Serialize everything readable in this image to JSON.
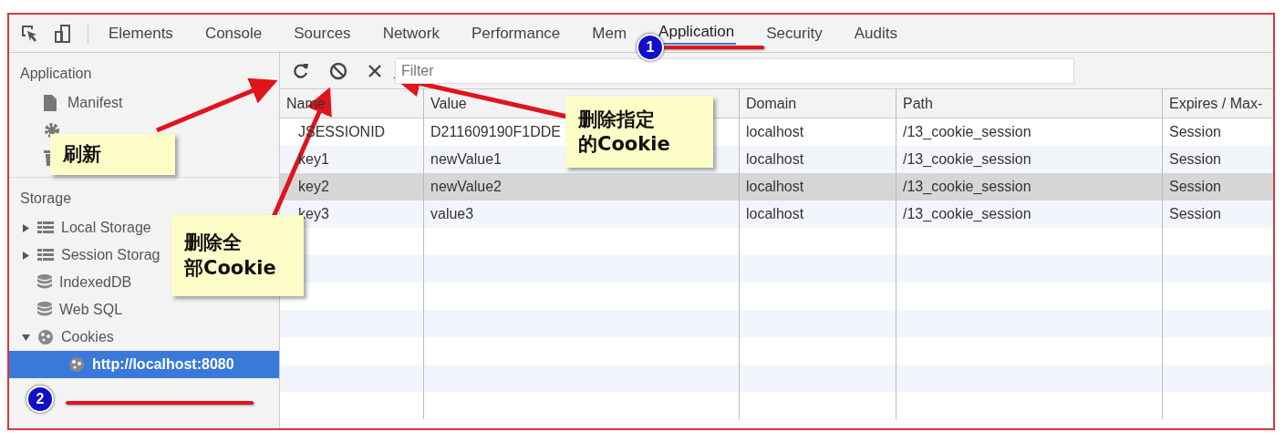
{
  "tabs": [
    {
      "label": "Elements",
      "selected": false
    },
    {
      "label": "Console",
      "selected": false
    },
    {
      "label": "Sources",
      "selected": false
    },
    {
      "label": "Network",
      "selected": false
    },
    {
      "label": "Performance",
      "selected": false
    },
    {
      "label": "Mem",
      "selected": false
    },
    {
      "label": "Application",
      "selected": true
    },
    {
      "label": "Security",
      "selected": false
    },
    {
      "label": "Audits",
      "selected": false
    }
  ],
  "sidebar": {
    "sections": [
      {
        "title": "Application",
        "items": [
          {
            "kind": "file",
            "label": "Manifest"
          },
          {
            "kind": "gear"
          },
          {
            "kind": "trash"
          }
        ]
      },
      {
        "title": "Storage",
        "items": [
          {
            "kind": "grid",
            "label": "Local Storage",
            "expanded": false
          },
          {
            "kind": "grid",
            "label": "Session Storag",
            "expanded": false
          },
          {
            "kind": "database",
            "label": "IndexedDB"
          },
          {
            "kind": "database",
            "label": "Web SQL"
          },
          {
            "kind": "cookie",
            "label": "Cookies",
            "expanded": true,
            "children": [
              {
                "kind": "cookie",
                "label": "http://localhost:8080",
                "selected": true
              }
            ]
          }
        ]
      }
    ]
  },
  "filter": {
    "placeholder": "Filter"
  },
  "table": {
    "columns": [
      "Name",
      "Value",
      "Domain",
      "Path",
      "Expires / Max-"
    ],
    "rows": [
      {
        "cells": [
          "JSESSIONID",
          "D211609190F1DDE",
          "localhost",
          "/13_cookie_session",
          "Session"
        ],
        "selected": false
      },
      {
        "cells": [
          "key1",
          "newValue1",
          "localhost",
          "/13_cookie_session",
          "Session"
        ],
        "selected": false
      },
      {
        "cells": [
          "key2",
          "newValue2",
          "localhost",
          "/13_cookie_session",
          "Session"
        ],
        "selected": true
      },
      {
        "cells": [
          "key3",
          "value3",
          "localhost",
          "/13_cookie_session",
          "Session"
        ],
        "selected": false
      }
    ]
  },
  "annotations": {
    "callouts": [
      {
        "lines": [
          "刷新"
        ]
      },
      {
        "lines": [
          "删除指定",
          "的Cookie"
        ]
      },
      {
        "lines": [
          "删除全",
          "部Cookie"
        ]
      }
    ],
    "badges": [
      "1",
      "2"
    ]
  }
}
